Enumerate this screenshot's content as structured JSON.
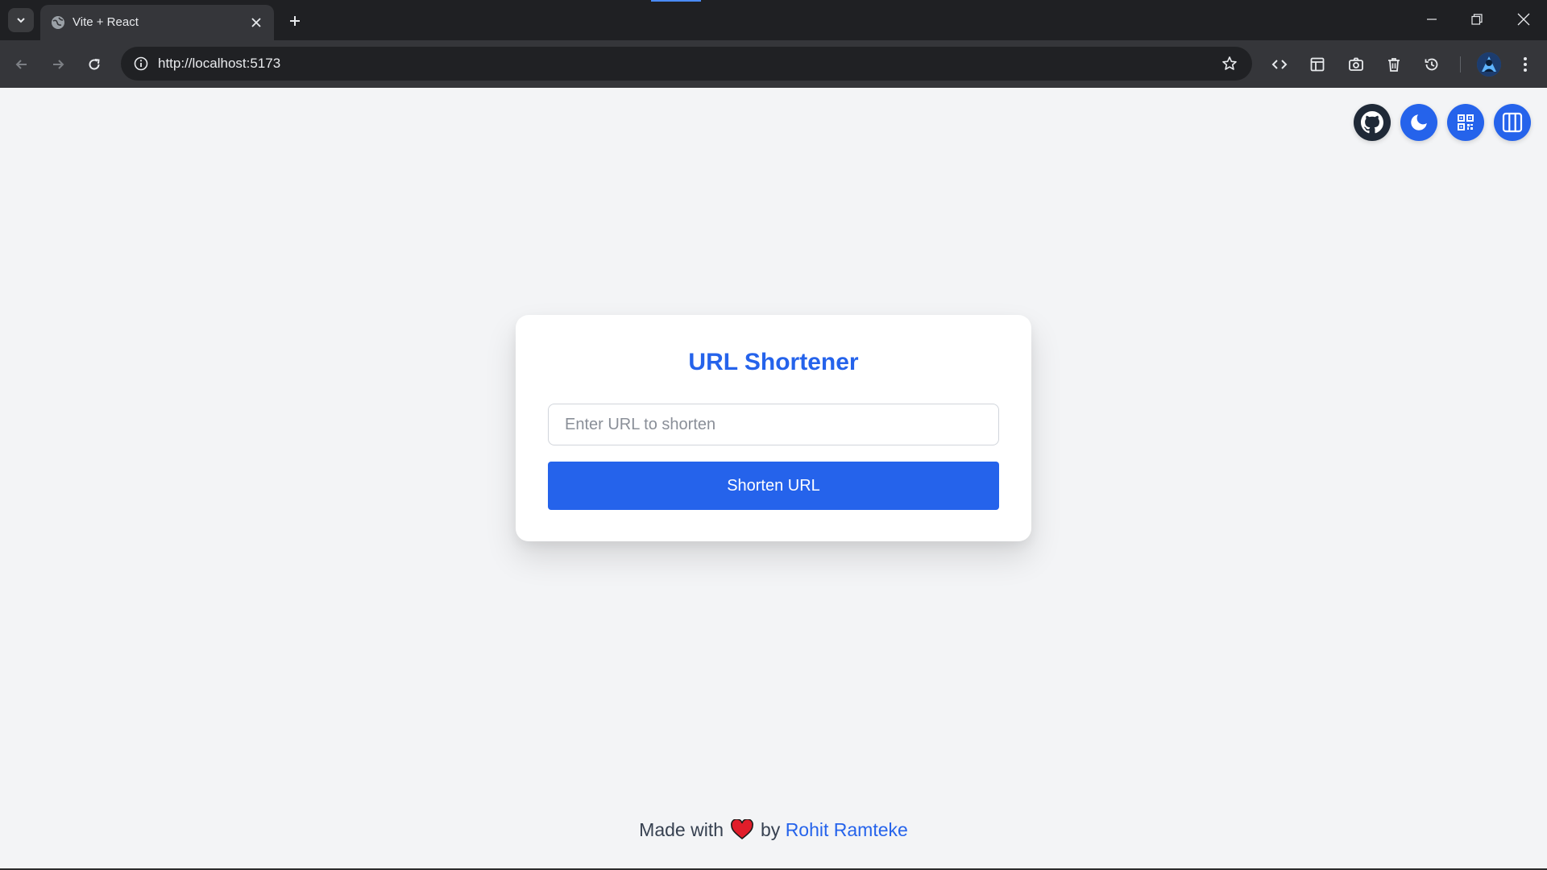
{
  "browser": {
    "tab_title": "Vite + React",
    "url": "http://localhost:5173",
    "icons": {
      "tab_search": "chevron-down-icon",
      "favicon": "globe-icon",
      "tab_close": "close-icon",
      "new_tab": "plus-icon",
      "back": "arrow-left-icon",
      "forward": "arrow-right-icon",
      "reload": "reload-icon",
      "site_info": "info-icon",
      "bookmark": "star-icon",
      "extensions": [
        "code-icon",
        "layout-icon",
        "camera-icon",
        "trash-icon",
        "history-icon"
      ],
      "menu": "kebab-menu-icon"
    }
  },
  "page": {
    "header_actions": [
      {
        "name": "github-icon",
        "bg": "#1f2937"
      },
      {
        "name": "moon-icon",
        "bg": "#2563eb"
      },
      {
        "name": "qr-code-icon",
        "bg": "#2563eb"
      },
      {
        "name": "columns-icon",
        "bg": "#2563eb"
      }
    ],
    "card": {
      "title": "URL Shortener",
      "input_placeholder": "Enter URL to shorten",
      "input_value": "",
      "button_label": "Shorten URL"
    },
    "footer": {
      "made_with": "Made with",
      "by": "by",
      "author": "Rohit Ramteke"
    }
  },
  "colors": {
    "accent": "#2563eb",
    "background": "#f3f4f6",
    "heart": "#e11d2a"
  }
}
